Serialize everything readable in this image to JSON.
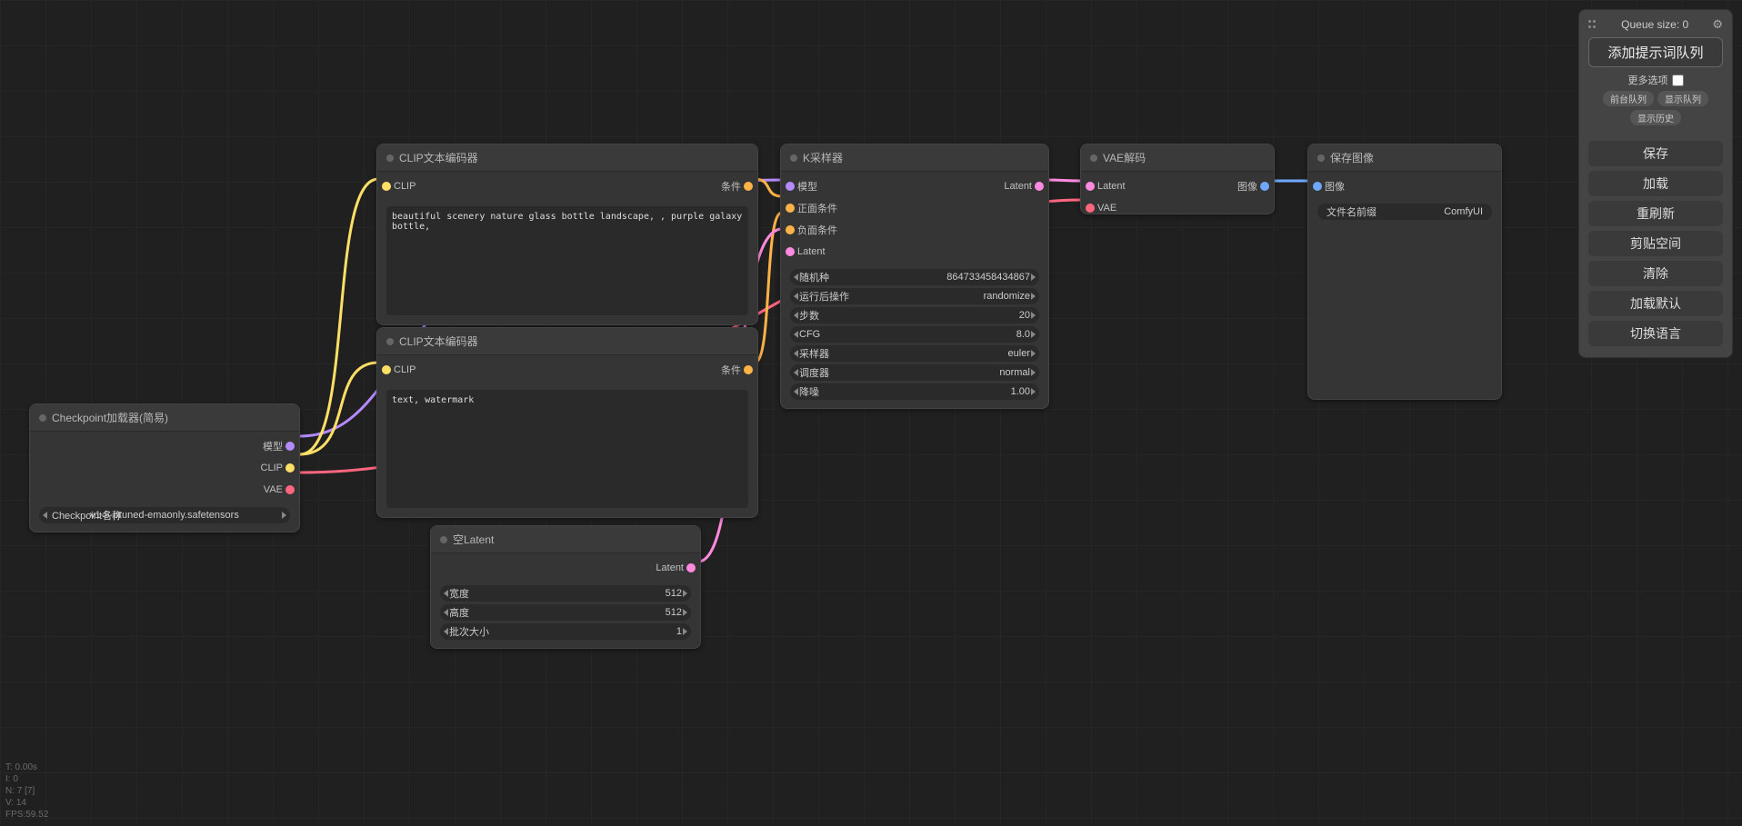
{
  "panel": {
    "queue_label": "Queue size: 0",
    "queue_prompt": "添加提示词队列",
    "extra_options": "更多选项",
    "front_queue": "前台队列",
    "show_queue": "显示队列",
    "show_history": "显示历史",
    "save": "保存",
    "load": "加载",
    "refresh": "重刷新",
    "clipspace": "剪贴空间",
    "clear": "清除",
    "load_default": "加载默认",
    "switch_lang": "切换语言"
  },
  "stats": {
    "t": "T: 0.00s",
    "i": "I: 0",
    "n": "N: 7 [7]",
    "v": "V: 14",
    "fps": "FPS:59.52"
  },
  "nodes": {
    "checkpoint": {
      "title": "Checkpoint加载器(简易)",
      "out_model": "模型",
      "out_clip": "CLIP",
      "out_vae": "VAE",
      "ckpt_label": "Checkpoint名称",
      "ckpt_value": "v1-5-pruned-emaonly.safetensors"
    },
    "clip_pos": {
      "title": "CLIP文本编码器",
      "in_clip": "CLIP",
      "out_cond": "条件",
      "text": "beautiful scenery nature glass bottle landscape, , purple galaxy bottle,"
    },
    "clip_neg": {
      "title": "CLIP文本编码器",
      "in_clip": "CLIP",
      "out_cond": "条件",
      "text": "text, watermark"
    },
    "latent": {
      "title": "空Latent",
      "out_latent": "Latent",
      "width_label": "宽度",
      "width_value": "512",
      "height_label": "高度",
      "height_value": "512",
      "batch_label": "批次大小",
      "batch_value": "1"
    },
    "ksampler": {
      "title": "K采样器",
      "in_model": "模型",
      "in_pos": "正面条件",
      "in_neg": "负面条件",
      "in_latent": "Latent",
      "out_latent": "Latent",
      "seed_label": "随机种",
      "seed_value": "864733458434867",
      "after_label": "运行后操作",
      "after_value": "randomize",
      "steps_label": "步数",
      "steps_value": "20",
      "cfg_label": "CFG",
      "cfg_value": "8.0",
      "sampler_label": "采样器",
      "sampler_value": "euler",
      "scheduler_label": "调度器",
      "scheduler_value": "normal",
      "denoise_label": "降噪",
      "denoise_value": "1.00"
    },
    "vae": {
      "title": "VAE解码",
      "in_latent": "Latent",
      "in_vae": "VAE",
      "out_image": "图像"
    },
    "save": {
      "title": "保存图像",
      "in_image": "图像",
      "prefix_label": "文件名前缀",
      "prefix_value": "ComfyUI"
    }
  }
}
